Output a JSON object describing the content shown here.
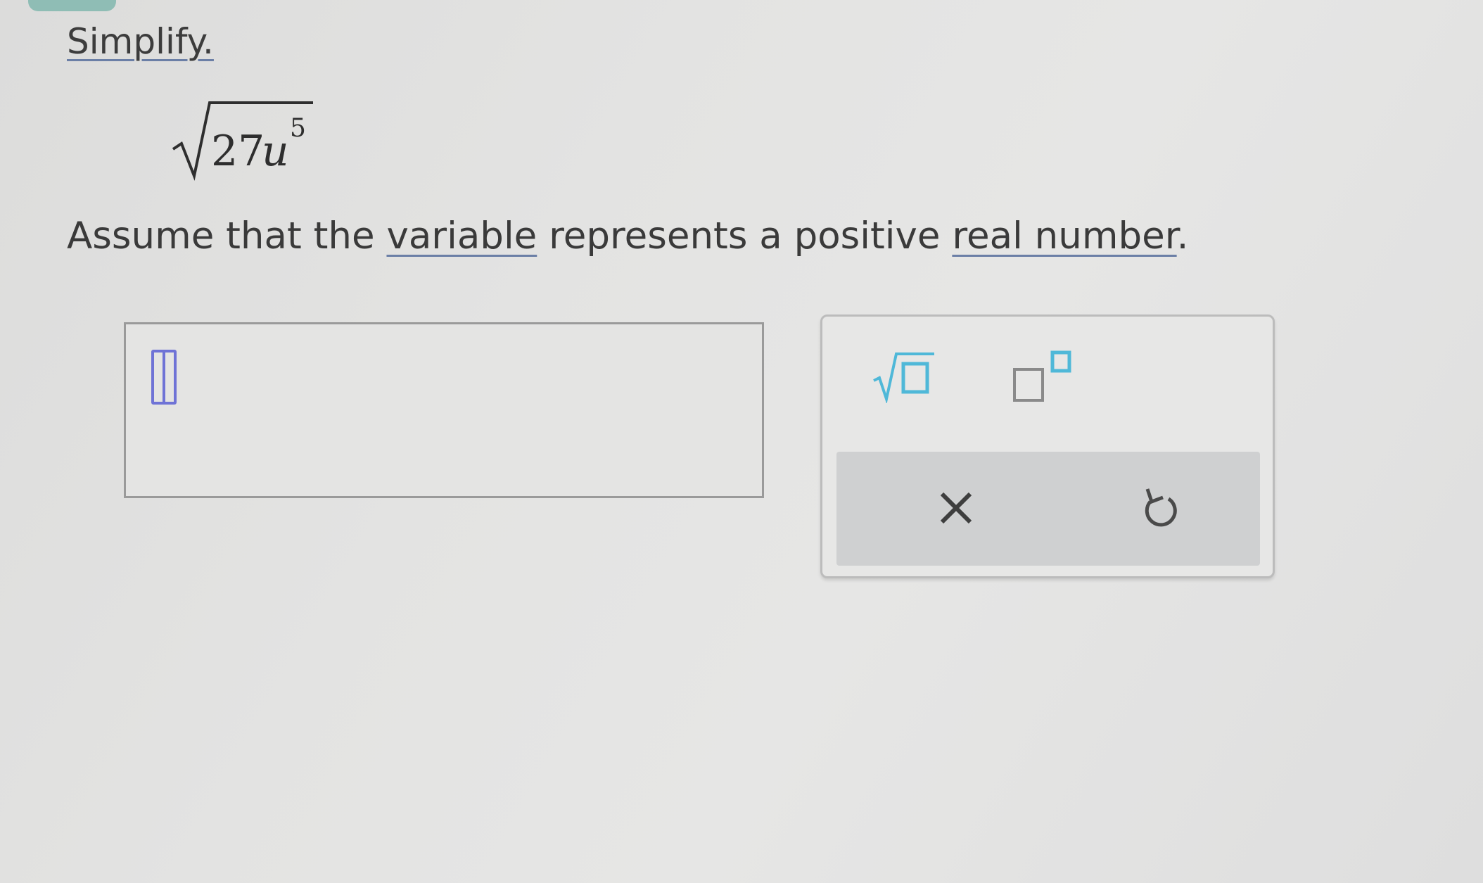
{
  "problem": {
    "instruction": "Simplify.",
    "expression": {
      "coefficient": "27",
      "variable": "u",
      "exponent": "5"
    },
    "assumption": {
      "part1": "Assume that the ",
      "link1": "variable",
      "part2": " represents a positive ",
      "link2": "real number",
      "part3": "."
    }
  },
  "answer": {
    "value": ""
  },
  "palette": {
    "buttons": [
      {
        "icon": "square-root-icon",
        "label": "square root"
      },
      {
        "icon": "exponent-icon",
        "label": "exponent"
      },
      {
        "icon": "close-icon",
        "label": "clear"
      },
      {
        "icon": "undo-icon",
        "label": "undo"
      }
    ],
    "accent_color": "#4fb8d8",
    "cursor_color": "#6f73d6"
  }
}
